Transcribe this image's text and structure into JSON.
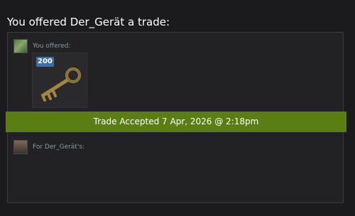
{
  "header": {
    "title": "You offered Der_Gerät a trade:"
  },
  "offer": {
    "you_offered_label": "You offered:",
    "items": [
      {
        "badge": "200",
        "icon": "key-icon"
      }
    ]
  },
  "status": {
    "banner_text": "Trade Accepted 7 Apr, 2026 @ 2:18pm",
    "banner_color": "#5b7e12"
  },
  "partner": {
    "for_label": "For Der_Gerät's:"
  },
  "colors": {
    "badge": "#3b6fa8",
    "background": "#1b1b1d",
    "panel": "#222225"
  }
}
